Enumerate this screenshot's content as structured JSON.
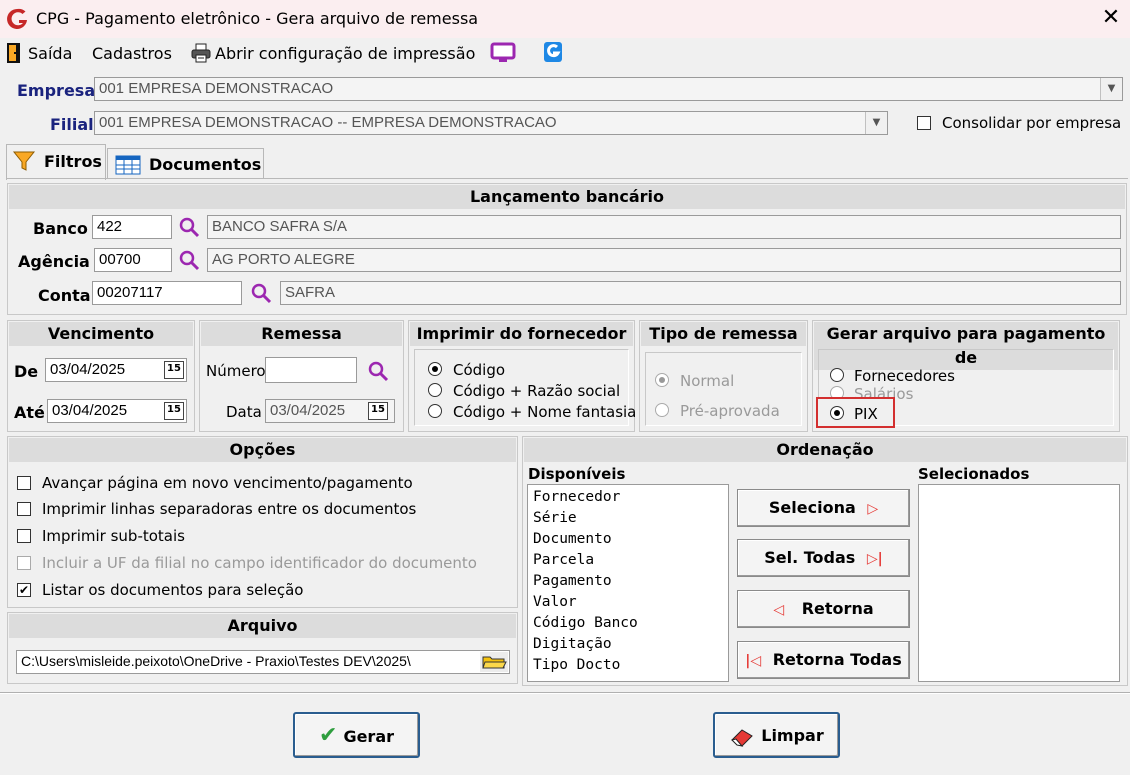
{
  "window": {
    "title": "CPG -  Pagamento eletrônico - Gera arquivo de remessa",
    "close_glyph": "✕"
  },
  "menu": {
    "items": [
      "Saída",
      "Cadastros",
      "Abrir configuração de impressão"
    ]
  },
  "header": {
    "empresa_label": "Empresa",
    "empresa_value": "001 EMPRESA DEMONSTRACAO",
    "filial_label": "Filial",
    "filial_value": "001 EMPRESA DEMONSTRACAO -- EMPRESA DEMONSTRACAO",
    "consolidar_label": "Consolidar por empresa"
  },
  "tabs": [
    {
      "label": "Filtros",
      "active": true,
      "icon": "filter-icon"
    },
    {
      "label": "Documentos",
      "active": false,
      "icon": "table-icon"
    }
  ],
  "lancamento": {
    "title": "Lançamento bancário",
    "banco_label": "Banco",
    "banco_code": "422",
    "banco_name": "BANCO SAFRA S/A",
    "agencia_label": "Agência",
    "agencia_code": "00700",
    "agencia_name": "AG PORTO ALEGRE",
    "conta_label": "Conta",
    "conta_code": "00207117",
    "conta_name": "SAFRA"
  },
  "vencimento": {
    "title": "Vencimento",
    "de_label": "De",
    "de_value": "03/04/2025",
    "ate_label": "Até",
    "ate_value": "03/04/2025",
    "cal_glyph": "15"
  },
  "remessa": {
    "title": "Remessa",
    "numero_label": "Número",
    "numero_value": "",
    "data_label": "Data",
    "data_value": "03/04/2025"
  },
  "imprimir": {
    "title": "Imprimir do fornecedor",
    "options": [
      "Código",
      "Código + Razão social",
      "Código + Nome fantasia"
    ],
    "selected": 0
  },
  "tipo_remessa": {
    "title": "Tipo de remessa",
    "options": [
      "Normal",
      "Pré-aprovada"
    ],
    "selected": 0
  },
  "gerar_para": {
    "title": "Gerar arquivo para pagamento de",
    "options": [
      "Fornecedores",
      "Salários",
      "PIX"
    ],
    "selected": 2
  },
  "opcoes": {
    "title": "Opções",
    "items": [
      {
        "label": "Avançar página em novo vencimento/pagamento",
        "checked": false,
        "disabled": false
      },
      {
        "label": "Imprimir linhas separadoras entre os documentos",
        "checked": false,
        "disabled": false
      },
      {
        "label": "Imprimir sub-totais",
        "checked": false,
        "disabled": false
      },
      {
        "label": "Incluir a UF da filial no campo identificador do documento",
        "checked": false,
        "disabled": true
      },
      {
        "label": "Listar os documentos para seleção",
        "checked": true,
        "disabled": false
      }
    ]
  },
  "arquivo": {
    "title": "Arquivo",
    "path": "C:\\Users\\misleide.peixoto\\OneDrive - Praxio\\Testes DEV\\2025\\"
  },
  "ordenacao": {
    "title": "Ordenação",
    "disponiveis_label": "Disponíveis",
    "selecionados_label": "Selecionados",
    "disponiveis": [
      "Fornecedor",
      "Série",
      "Documento",
      "Parcela",
      "Pagamento",
      "Valor",
      "Código Banco",
      "Digitação",
      "Tipo Docto"
    ],
    "selecionados": [],
    "btn_seleciona": "Seleciona",
    "btn_sel_todas": "Sel. Todas",
    "btn_retorna": "Retorna",
    "btn_retorna_todas": "Retorna Todas"
  },
  "footer": {
    "gerar": "Gerar",
    "limpar": "Limpar"
  },
  "colors": {
    "accent_blue": "#1a237e",
    "highlight_red": "#d32f2f",
    "icon_purple": "#9c27b0",
    "brand_blue": "#1e88e5"
  }
}
